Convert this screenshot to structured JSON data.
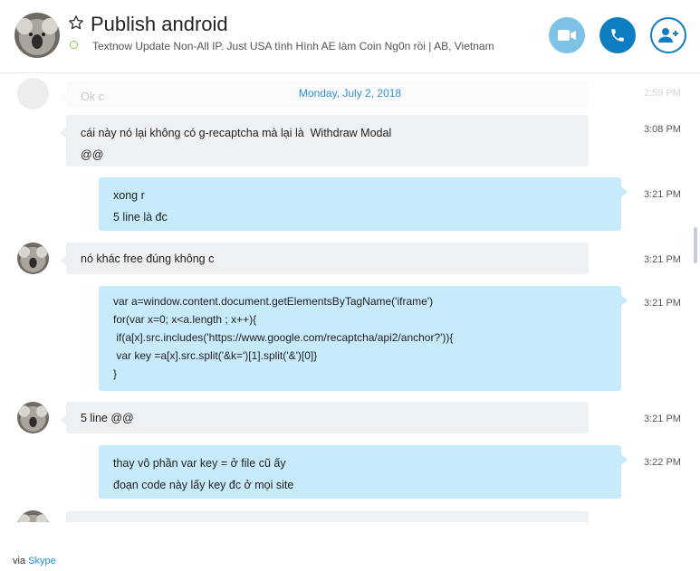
{
  "header": {
    "title": "Publish android",
    "mood": "Textnow Update Non-All IP. Just USA tình Hình AE làm Coin Ng0n rồi  |  AB, Vietnam",
    "status_color": "#8cc63f"
  },
  "chat": {
    "date_separator": "Monday, July 2, 2018",
    "ghost_message": {
      "text": "Ok c",
      "time": "2:59 PM"
    },
    "messages": [
      {
        "direction": "in",
        "lines": [
          "cái này nó lại không có g-recaptcha mà lại là  Withdraw Modal",
          "@@"
        ],
        "time": "3:08 PM"
      },
      {
        "direction": "out",
        "lines": [
          "xong r",
          "5 line là đc"
        ],
        "time": "3:21 PM"
      },
      {
        "direction": "in",
        "lines": [
          "nó khác free đúng không c"
        ],
        "time": "3:21 PM"
      },
      {
        "direction": "out",
        "lines": [
          "var a=window.content.document.getElementsByTagName('iframe')",
          "for(var x=0; x<a.length ; x++){",
          " if(a[x].src.includes('https://www.google.com/recaptcha/api2/anchor?')){",
          " var key =a[x].src.split('&k=')[1].split('&')[0]}",
          "}"
        ],
        "time": "3:21 PM"
      },
      {
        "direction": "in",
        "lines": [
          "5 line @@"
        ],
        "time": "3:21 PM"
      },
      {
        "direction": "out",
        "lines": [
          "thay vô phần var key = ở file cũ ấy",
          "đoạn code này lấy key đc ở mọi site"
        ],
        "time": "3:22 PM"
      }
    ]
  },
  "footer": {
    "via": "via",
    "link": "Skype"
  },
  "colors": {
    "accent": "#0f7dc2",
    "incoming_bubble": "#eef1f4",
    "outgoing_bubble": "#c7ebfa"
  }
}
